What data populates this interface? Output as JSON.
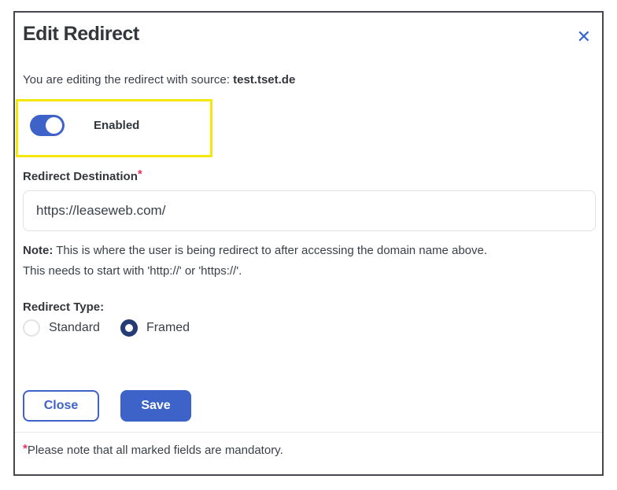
{
  "modal": {
    "title": "Edit Redirect",
    "close_icon": "✕",
    "intro": {
      "text": "You are editing the redirect with source: ",
      "source": "test.tset.de"
    },
    "toggle": {
      "label": "Enabled",
      "state": "on"
    },
    "destination": {
      "label": "Redirect Destination",
      "required_mark": "*",
      "value": "https://leaseweb.com/"
    },
    "note": {
      "prefix": "Note:",
      "line1": " This is where the user is being redirect to after accessing the domain name above.",
      "line2": "This needs to start with 'http://' or 'https://'."
    },
    "redirect_type": {
      "label": "Redirect Type:",
      "options": [
        {
          "label": "Standard",
          "selected": false
        },
        {
          "label": "Framed",
          "selected": true
        }
      ]
    },
    "buttons": {
      "close": "Close",
      "save": "Save"
    },
    "footer": {
      "mark": "*",
      "text": "Please note that all marked fields are mandatory."
    }
  },
  "colors": {
    "primary_blue": "#3d63c9",
    "radio_selected_navy": "#243b73",
    "highlight_yellow": "#f6e70b",
    "required_pink": "#f12f5e",
    "modal_border": "#46484c",
    "text_dark": "#33363b"
  }
}
